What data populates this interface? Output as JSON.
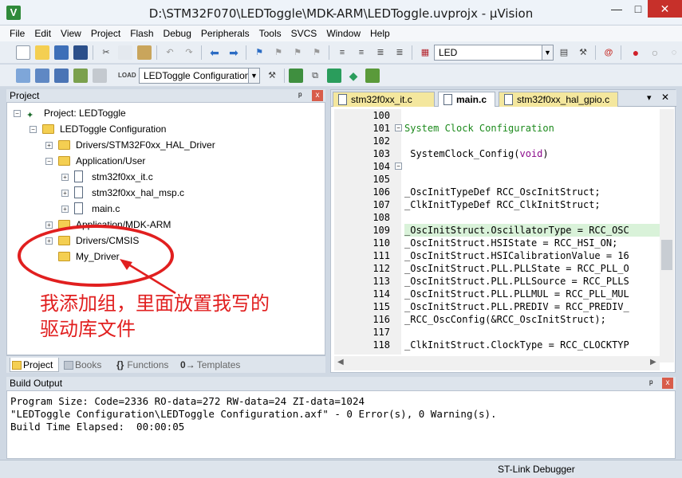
{
  "window": {
    "title": "D:\\STM32F070\\LEDToggle\\MDK-ARM\\LEDToggle.uvprojx - µVision",
    "min": "—",
    "max": "□",
    "close": "✕"
  },
  "menu": [
    "File",
    "Edit",
    "View",
    "Project",
    "Flash",
    "Debug",
    "Peripherals",
    "Tools",
    "SVCS",
    "Window",
    "Help"
  ],
  "toolbar": {
    "find_value": "LED",
    "target_value": "LEDToggle Configuration"
  },
  "project_panel": {
    "title": "Project",
    "pin": "ᵖ",
    "close": "x",
    "tree": [
      {
        "label": "Project: LEDToggle"
      },
      {
        "label": "LEDToggle Configuration"
      },
      {
        "label": "Drivers/STM32F0xx_HAL_Driver"
      },
      {
        "label": "Application/User"
      },
      {
        "label": "stm32f0xx_it.c"
      },
      {
        "label": "stm32f0xx_hal_msp.c"
      },
      {
        "label": "main.c"
      },
      {
        "label": "Application/MDK-ARM"
      },
      {
        "label": "Drivers/CMSIS"
      },
      {
        "label": "My_Driver"
      }
    ],
    "tabs": [
      "Project",
      "Books",
      "Functions",
      "Templates"
    ]
  },
  "editor": {
    "tabs": [
      "stm32f0xx_it.c",
      "main.c",
      "stm32f0xx_hal_gpio.c"
    ],
    "close": "✕",
    "lines": [
      {
        "num": "100",
        "code": ""
      },
      {
        "num": "101",
        "code": "System Clock Configuration"
      },
      {
        "num": "102",
        "code": ""
      },
      {
        "num": "103",
        "code": " SystemClock_Config(void)"
      },
      {
        "num": "104",
        "code": ""
      },
      {
        "num": "105",
        "code": ""
      },
      {
        "num": "106",
        "code": "_OscInitTypeDef RCC_OscInitStruct;"
      },
      {
        "num": "107",
        "code": "_ClkInitTypeDef RCC_ClkInitStruct;"
      },
      {
        "num": "108",
        "code": ""
      },
      {
        "num": "109",
        "code": "_OscInitStruct.OscillatorType = RCC_OSC"
      },
      {
        "num": "110",
        "code": "_OscInitStruct.HSIState = RCC_HSI_ON;"
      },
      {
        "num": "111",
        "code": "_OscInitStruct.HSICalibrationValue = 16"
      },
      {
        "num": "112",
        "code": "_OscInitStruct.PLL.PLLState = RCC_PLL_O"
      },
      {
        "num": "113",
        "code": "_OscInitStruct.PLL.PLLSource = RCC_PLLS"
      },
      {
        "num": "114",
        "code": "_OscInitStruct.PLL.PLLMUL = RCC_PLL_MUL"
      },
      {
        "num": "115",
        "code": "_OscInitStruct.PLL.PREDIV = RCC_PREDIV_"
      },
      {
        "num": "116",
        "code": "_RCC_OscConfig(&RCC_OscInitStruct);"
      },
      {
        "num": "117",
        "code": ""
      },
      {
        "num": "118",
        "code": "_ClkInitStruct.ClockType = RCC_CLOCKTYP"
      }
    ]
  },
  "build_output": {
    "title": "Build Output",
    "lines": [
      "Program Size: Code=2336 RO-data=272 RW-data=24 ZI-data=1024",
      "\"LEDToggle Configuration\\LEDToggle Configuration.axf\" - 0 Error(s), 0 Warning(s).",
      "Build Time Elapsed:  00:00:05"
    ]
  },
  "status": {
    "debugger": "ST-Link Debugger"
  },
  "annotation": {
    "line1": "我添加组，里面放置我写的",
    "line2": "驱动库文件"
  },
  "colors": {
    "annotation": "#e11f1f",
    "close_button": "#c7302a"
  }
}
